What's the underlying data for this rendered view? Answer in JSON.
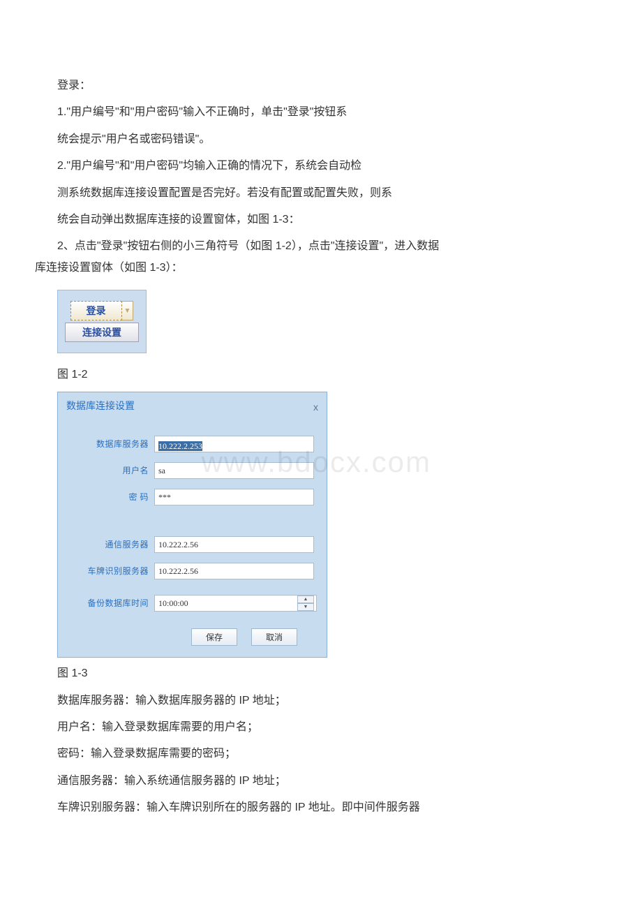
{
  "text": {
    "p0": "登录：",
    "p1": "1.\"用户编号\"和\"用户密码\"输入不正确时，单击\"登录\"按钮系",
    "p2": "统会提示\"用户名或密码错误\"。",
    "p3": "2.\"用户编号\"和\"用户密码\"均输入正确的情况下，系统会自动检",
    "p4": "测系统数据库连接设置配置是否完好。若没有配置或配置失败，则系",
    "p5": "统会自动弹出数据库连接的设置窗体，如图 1-3：",
    "p6a": "2、点击\"登录\"按钮右侧的小三角符号（如图 1-2），点击\"连接设置\"，进入数据",
    "p6b": "库连接设置窗体（如图 1-3）：",
    "caption1": "图 1-2",
    "caption2": "图 1-3",
    "d1": "数据库服务器：输入数据库服务器的 IP 地址；",
    "d2": "用户名：输入登录数据库需要的用户名；",
    "d3": "密码：输入登录数据库需要的密码；",
    "d4": "通信服务器：输入系统通信服务器的 IP 地址；",
    "d5": "车牌识别服务器：输入车牌识别所在的服务器的 IP 地址。即中间件服务器"
  },
  "loginMenu": {
    "login": "登录",
    "connection": "连接设置"
  },
  "dbDialog": {
    "title": "数据库连接设置",
    "close": "x",
    "labels": {
      "dbserver": "数据库服务器",
      "username": "用户名",
      "password": "密  码",
      "comserver": "通信服务器",
      "plateserver": "车牌识别服务器",
      "backuptime": "备份数据库时间"
    },
    "values": {
      "dbserver": "10.222.2.253",
      "username": "sa",
      "password": "***",
      "comserver": "10.222.2.56",
      "plateserver": "10.222.2.56",
      "backuptime": "10:00:00"
    },
    "buttons": {
      "save": "保存",
      "cancel": "取消"
    }
  },
  "watermark": "www.bdocx.com"
}
